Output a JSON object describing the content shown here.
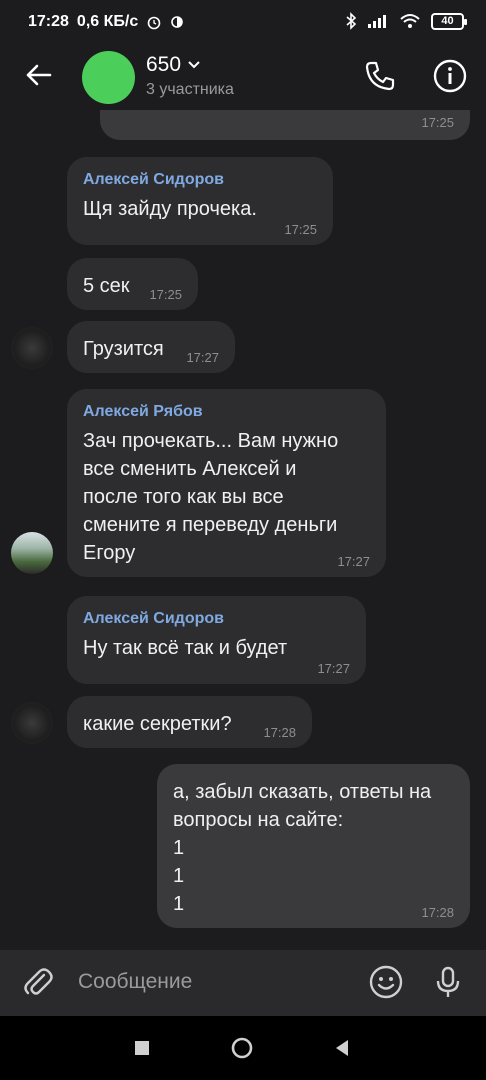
{
  "status_bar": {
    "time": "17:28",
    "speed": "0,6 КБ/с",
    "battery": "40"
  },
  "header": {
    "title": "650",
    "subtitle": "3 участника"
  },
  "messages": [
    {
      "time": "17:25"
    },
    {
      "sender": "Алексей Сидоров",
      "text": "Щя зайду прочека.",
      "time": "17:25"
    },
    {
      "text": "5 сек",
      "time": "17:25"
    },
    {
      "text": "Грузится",
      "time": "17:27"
    },
    {
      "sender": "Алексей Рябов",
      "text": "Зач прочекать... Вам нужно\nвсе сменить Алексей и\nпосле того как вы все\nсмените я переведу деньги\nЕгору",
      "time": "17:27"
    },
    {
      "sender": "Алексей Сидоров",
      "text": "Ну так всё так и будет",
      "time": "17:27"
    },
    {
      "text": "какие секретки?",
      "time": "17:28"
    },
    {
      "text": "а, забыл сказать, ответы на\nвопросы на сайте:\n1\n1\n1",
      "time": "17:28"
    }
  ],
  "composer": {
    "placeholder": "Сообщение"
  }
}
